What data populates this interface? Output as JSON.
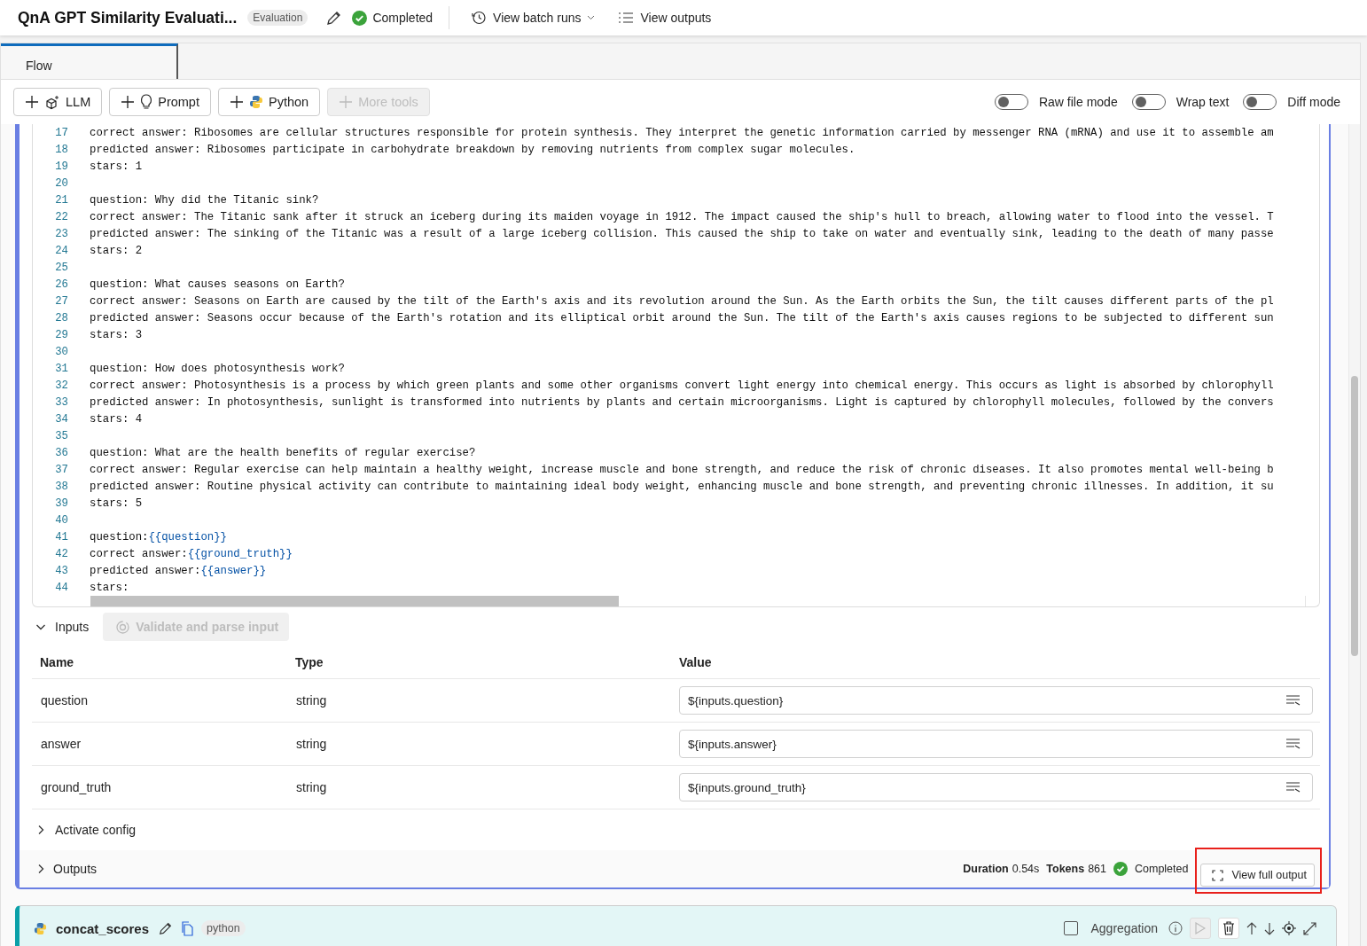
{
  "header": {
    "title": "QnA GPT Similarity Evaluati...",
    "badge": "Evaluation",
    "status": "Completed",
    "actions": [
      {
        "label": "View batch runs",
        "kind": "dropdown"
      },
      {
        "label": "View outputs",
        "kind": "list"
      }
    ]
  },
  "tabs": [
    {
      "label": "Flow",
      "selected": true
    }
  ],
  "toolbar": {
    "tools": [
      {
        "label": "LLM",
        "kind": "llm",
        "disabled": false
      },
      {
        "label": "Prompt",
        "kind": "prompt",
        "disabled": false
      },
      {
        "label": "Python",
        "kind": "python",
        "disabled": false
      },
      {
        "label": "More tools",
        "kind": "more",
        "disabled": true
      }
    ],
    "toggles": [
      {
        "label": "Raw file mode",
        "on": false
      },
      {
        "label": "Wrap text",
        "on": false
      },
      {
        "label": "Diff mode",
        "on": false
      }
    ]
  },
  "code": {
    "lines": [
      {
        "number": "17",
        "text": "correct answer: Ribosomes are cellular structures responsible for protein synthesis. They interpret the genetic information carried by messenger RNA (mRNA) and use it to assemble am"
      },
      {
        "number": "18",
        "text": "predicted answer: Ribosomes participate in carbohydrate breakdown by removing nutrients from complex sugar molecules."
      },
      {
        "number": "19",
        "text": "stars: 1"
      },
      {
        "number": "20"
      },
      {
        "number": "21",
        "text": "question: Why did the Titanic sink?"
      },
      {
        "number": "22",
        "text": "correct answer: The Titanic sank after it struck an iceberg during its maiden voyage in 1912. The impact caused the ship's hull to breach, allowing water to flood into the vessel. T"
      },
      {
        "number": "23",
        "text": "predicted answer: The sinking of the Titanic was a result of a large iceberg collision. This caused the ship to take on water and eventually sink, leading to the death of many passe"
      },
      {
        "number": "24",
        "text": "stars: 2"
      },
      {
        "number": "25"
      },
      {
        "number": "26",
        "text": "question: What causes seasons on Earth?"
      },
      {
        "number": "27",
        "text": "correct answer: Seasons on Earth are caused by the tilt of the Earth's axis and its revolution around the Sun. As the Earth orbits the Sun, the tilt causes different parts of the pl"
      },
      {
        "number": "28",
        "text": "predicted answer: Seasons occur because of the Earth's rotation and its elliptical orbit around the Sun. The tilt of the Earth's axis causes regions to be subjected to different sun"
      },
      {
        "number": "29",
        "text": "stars: 3"
      },
      {
        "number": "30"
      },
      {
        "number": "31",
        "text": "question: How does photosynthesis work?"
      },
      {
        "number": "32",
        "text": "correct answer: Photosynthesis is a process by which green plants and some other organisms convert light energy into chemical energy. This occurs as light is absorbed by chlorophyll"
      },
      {
        "number": "33",
        "text": "predicted answer: In photosynthesis, sunlight is transformed into nutrients by plants and certain microorganisms. Light is captured by chlorophyll molecules, followed by the convers"
      },
      {
        "number": "34",
        "text": "stars: 4"
      },
      {
        "number": "35"
      },
      {
        "number": "36",
        "text": "question: What are the health benefits of regular exercise?"
      },
      {
        "number": "37",
        "text": "correct answer: Regular exercise can help maintain a healthy weight, increase muscle and bone strength, and reduce the risk of chronic diseases. It also promotes mental well-being b"
      },
      {
        "number": "38",
        "text": "predicted answer: Routine physical activity can contribute to maintaining ideal body weight, enhancing muscle and bone strength, and preventing chronic illnesses. In addition, it su"
      },
      {
        "number": "39",
        "text": "stars: 5"
      },
      {
        "number": "40"
      },
      {
        "number": "41",
        "text": "question:",
        "variable": "{{question}}"
      },
      {
        "number": "42",
        "text": "correct answer:",
        "variable": "{{ground_truth}}"
      },
      {
        "number": "43",
        "text": "predicted answer:",
        "variable": "{{answer}}"
      },
      {
        "number": "44",
        "text": "stars:"
      }
    ]
  },
  "inputs": {
    "title": "Inputs",
    "expanded": true,
    "validate_button": {
      "label": "Validate and parse input",
      "disabled": true
    },
    "columns": [
      "Name",
      "Type",
      "Value"
    ],
    "rows": [
      {
        "name": "question",
        "type": "string",
        "value": "${inputs.question}"
      },
      {
        "name": "answer",
        "type": "string",
        "value": "${inputs.answer}"
      },
      {
        "name": "ground_truth",
        "type": "string",
        "value": "${inputs.ground_truth}"
      }
    ]
  },
  "activate_config": {
    "label": "Activate config",
    "expanded": false
  },
  "outputs": {
    "label": "Outputs",
    "expanded": false,
    "duration_label": "Duration",
    "duration": "0.54s",
    "tokens_label": "Tokens",
    "tokens": "861",
    "status": "Completed",
    "view_button": "View full output"
  },
  "next_node": {
    "name": "concat_scores",
    "type": "python",
    "aggregation_label": "Aggregation",
    "aggregation_checked": false
  }
}
